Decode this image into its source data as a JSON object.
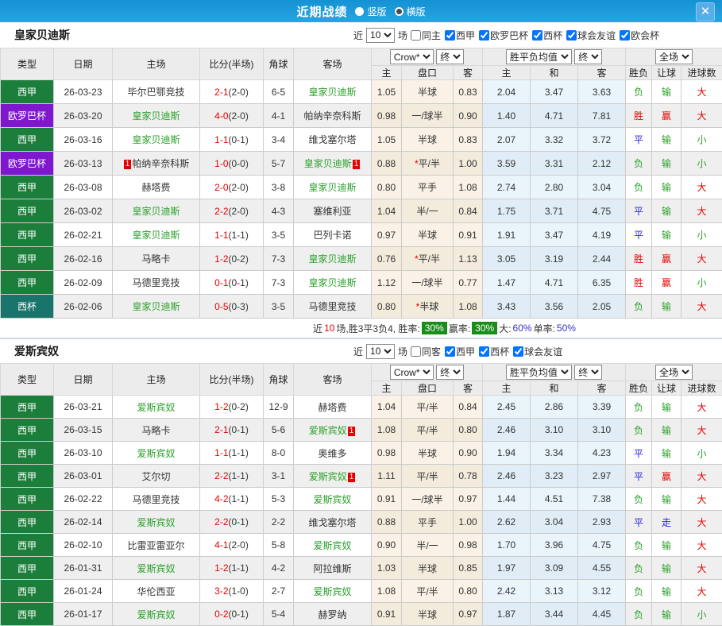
{
  "titlebar": {
    "title": "近期战绩",
    "radio_vertical": "竖版",
    "radio_horizontal": "横版",
    "close": "✕"
  },
  "header": {
    "near": "近",
    "games": "10",
    "games_unit": "场",
    "col_type": "类型",
    "col_date": "日期",
    "col_home": "主场",
    "col_score": "比分(半场)",
    "col_corner": "角球",
    "col_away": "客场",
    "dd_odds_src": "Crow*",
    "dd_odds_state": "终",
    "dd_avg_src": "胜平负均值",
    "dd_avg_state": "终",
    "dd_scope": "全场",
    "sub_odds": [
      "主",
      "盘口",
      "客"
    ],
    "sub_avg": [
      "主",
      "和",
      "客"
    ],
    "sub_res": [
      "胜负",
      "让球",
      "进球数"
    ]
  },
  "colors": {
    "league": {
      "西甲": "#1b7e3a",
      "欧罗巴杯": "#7e17cd",
      "西杯": "#19756c"
    },
    "win_red": "#e60000",
    "draw_blue": "#2828d8",
    "lose_green": "#2ba12b"
  },
  "sections": [
    {
      "team": "皇家贝迪斯",
      "filters": [
        {
          "label": "同主",
          "checked": false
        },
        {
          "label": "西甲",
          "checked": true
        },
        {
          "label": "欧罗巴杯",
          "checked": true
        },
        {
          "label": "西杯",
          "checked": true
        },
        {
          "label": "球会友谊",
          "checked": true
        },
        {
          "label": "欧会杯",
          "checked": true
        }
      ],
      "rows": [
        {
          "league": "西甲",
          "date": "26-03-23",
          "home": "毕尔巴鄂竞技",
          "home_hl": false,
          "home_card": false,
          "score": "2-1",
          "half": "(2-0)",
          "corner": "6-5",
          "away": "皇家贝迪斯",
          "away_hl": true,
          "away_card": false,
          "odds": [
            "1.05",
            "半球",
            "0.83"
          ],
          "star": false,
          "avg": [
            "2.04",
            "3.47",
            "3.63"
          ],
          "res": [
            "负",
            "输",
            "大"
          ]
        },
        {
          "league": "欧罗巴杯",
          "date": "26-03-20",
          "home": "皇家贝迪斯",
          "home_hl": true,
          "home_card": false,
          "score": "4-0",
          "half": "(2-0)",
          "corner": "4-1",
          "away": "帕纳辛奈科斯",
          "away_hl": false,
          "away_card": false,
          "odds": [
            "0.98",
            "一/球半",
            "0.90"
          ],
          "star": false,
          "avg": [
            "1.40",
            "4.71",
            "7.81"
          ],
          "res": [
            "胜",
            "赢",
            "大"
          ]
        },
        {
          "league": "西甲",
          "date": "26-03-16",
          "home": "皇家贝迪斯",
          "home_hl": true,
          "home_card": false,
          "score": "1-1",
          "half": "(0-1)",
          "corner": "3-4",
          "away": "维戈塞尔塔",
          "away_hl": false,
          "away_card": false,
          "odds": [
            "1.05",
            "半球",
            "0.83"
          ],
          "star": false,
          "avg": [
            "2.07",
            "3.32",
            "3.72"
          ],
          "res": [
            "平",
            "输",
            "小"
          ]
        },
        {
          "league": "欧罗巴杯",
          "date": "26-03-13",
          "home": "帕纳辛奈科斯",
          "home_hl": false,
          "home_card": true,
          "score": "1-0",
          "half": "(0-0)",
          "corner": "5-7",
          "away": "皇家贝迪斯",
          "away_hl": true,
          "away_card": true,
          "odds": [
            "0.88",
            "平/半",
            "1.00"
          ],
          "star": true,
          "avg": [
            "3.59",
            "3.31",
            "2.12"
          ],
          "res": [
            "负",
            "输",
            "小"
          ]
        },
        {
          "league": "西甲",
          "date": "26-03-08",
          "home": "赫塔费",
          "home_hl": false,
          "home_card": false,
          "score": "2-0",
          "half": "(2-0)",
          "corner": "3-8",
          "away": "皇家贝迪斯",
          "away_hl": true,
          "away_card": false,
          "odds": [
            "0.80",
            "平手",
            "1.08"
          ],
          "star": false,
          "avg": [
            "2.74",
            "2.80",
            "3.04"
          ],
          "res": [
            "负",
            "输",
            "大"
          ]
        },
        {
          "league": "西甲",
          "date": "26-03-02",
          "home": "皇家贝迪斯",
          "home_hl": true,
          "home_card": false,
          "score": "2-2",
          "half": "(2-0)",
          "corner": "4-3",
          "away": "塞维利亚",
          "away_hl": false,
          "away_card": false,
          "odds": [
            "1.04",
            "半/一",
            "0.84"
          ],
          "star": false,
          "avg": [
            "1.75",
            "3.71",
            "4.75"
          ],
          "res": [
            "平",
            "输",
            "大"
          ]
        },
        {
          "league": "西甲",
          "date": "26-02-21",
          "home": "皇家贝迪斯",
          "home_hl": true,
          "home_card": false,
          "score": "1-1",
          "half": "(1-1)",
          "corner": "3-5",
          "away": "巴列卡诺",
          "away_hl": false,
          "away_card": false,
          "odds": [
            "0.97",
            "半球",
            "0.91"
          ],
          "star": false,
          "avg": [
            "1.91",
            "3.47",
            "4.19"
          ],
          "res": [
            "平",
            "输",
            "小"
          ]
        },
        {
          "league": "西甲",
          "date": "26-02-16",
          "home": "马略卡",
          "home_hl": false,
          "home_card": false,
          "score": "1-2",
          "half": "(0-2)",
          "corner": "7-3",
          "away": "皇家贝迪斯",
          "away_hl": true,
          "away_card": false,
          "odds": [
            "0.76",
            "平/半",
            "1.13"
          ],
          "star": true,
          "avg": [
            "3.05",
            "3.19",
            "2.44"
          ],
          "res": [
            "胜",
            "赢",
            "大"
          ]
        },
        {
          "league": "西甲",
          "date": "26-02-09",
          "home": "马德里竞技",
          "home_hl": false,
          "home_card": false,
          "score": "0-1",
          "half": "(0-1)",
          "corner": "7-3",
          "away": "皇家贝迪斯",
          "away_hl": true,
          "away_card": false,
          "odds": [
            "1.12",
            "一/球半",
            "0.77"
          ],
          "star": false,
          "avg": [
            "1.47",
            "4.71",
            "6.35"
          ],
          "res": [
            "胜",
            "赢",
            "小"
          ]
        },
        {
          "league": "西杯",
          "date": "26-02-06",
          "home": "皇家贝迪斯",
          "home_hl": true,
          "home_card": false,
          "score": "0-5",
          "half": "(0-3)",
          "corner": "3-5",
          "away": "马德里竞技",
          "away_hl": false,
          "away_card": false,
          "odds": [
            "0.80",
            "半球",
            "1.08"
          ],
          "star": true,
          "avg": [
            "3.43",
            "3.56",
            "2.05"
          ],
          "res": [
            "负",
            "输",
            "大"
          ]
        }
      ],
      "summary": {
        "pre": "近",
        "n": "10",
        "mid": "场,胜3平3负4, 胜率:",
        "win_rate": "30%",
        "mid2": "赢率:",
        "profit_rate": "30%",
        "mid3": "大:",
        "big_rate": "60%",
        "mid4": "单率:",
        "single_rate": "50%"
      }
    },
    {
      "team": "爱斯宾奴",
      "filters": [
        {
          "label": "同客",
          "checked": false
        },
        {
          "label": "西甲",
          "checked": true
        },
        {
          "label": "西杯",
          "checked": true
        },
        {
          "label": "球会友谊",
          "checked": true
        }
      ],
      "rows": [
        {
          "league": "西甲",
          "date": "26-03-21",
          "home": "爱斯宾奴",
          "home_hl": true,
          "home_card": false,
          "score": "1-2",
          "half": "(0-2)",
          "corner": "12-9",
          "away": "赫塔费",
          "away_hl": false,
          "away_card": false,
          "odds": [
            "1.04",
            "平/半",
            "0.84"
          ],
          "star": false,
          "avg": [
            "2.45",
            "2.86",
            "3.39"
          ],
          "res": [
            "负",
            "输",
            "大"
          ]
        },
        {
          "league": "西甲",
          "date": "26-03-15",
          "home": "马略卡",
          "home_hl": false,
          "home_card": false,
          "score": "2-1",
          "half": "(0-1)",
          "corner": "5-6",
          "away": "爱斯宾奴",
          "away_hl": true,
          "away_card": true,
          "odds": [
            "1.08",
            "平/半",
            "0.80"
          ],
          "star": false,
          "avg": [
            "2.46",
            "3.10",
            "3.10"
          ],
          "res": [
            "负",
            "输",
            "大"
          ]
        },
        {
          "league": "西甲",
          "date": "26-03-10",
          "home": "爱斯宾奴",
          "home_hl": true,
          "home_card": false,
          "score": "1-1",
          "half": "(1-1)",
          "corner": "8-0",
          "away": "奥维多",
          "away_hl": false,
          "away_card": false,
          "odds": [
            "0.98",
            "半球",
            "0.90"
          ],
          "star": false,
          "avg": [
            "1.94",
            "3.34",
            "4.23"
          ],
          "res": [
            "平",
            "输",
            "小"
          ]
        },
        {
          "league": "西甲",
          "date": "26-03-01",
          "home": "艾尔切",
          "home_hl": false,
          "home_card": false,
          "score": "2-2",
          "half": "(1-1)",
          "corner": "3-1",
          "away": "爱斯宾奴",
          "away_hl": true,
          "away_card": true,
          "odds": [
            "1.11",
            "平/半",
            "0.78"
          ],
          "star": false,
          "avg": [
            "2.46",
            "3.23",
            "2.97"
          ],
          "res": [
            "平",
            "赢",
            "大"
          ]
        },
        {
          "league": "西甲",
          "date": "26-02-22",
          "home": "马德里竞技",
          "home_hl": false,
          "home_card": false,
          "score": "4-2",
          "half": "(1-1)",
          "corner": "5-3",
          "away": "爱斯宾奴",
          "away_hl": true,
          "away_card": false,
          "odds": [
            "0.91",
            "一/球半",
            "0.97"
          ],
          "star": false,
          "avg": [
            "1.44",
            "4.51",
            "7.38"
          ],
          "res": [
            "负",
            "输",
            "大"
          ]
        },
        {
          "league": "西甲",
          "date": "26-02-14",
          "home": "爱斯宾奴",
          "home_hl": true,
          "home_card": false,
          "score": "2-2",
          "half": "(0-1)",
          "corner": "2-2",
          "away": "维戈塞尔塔",
          "away_hl": false,
          "away_card": false,
          "odds": [
            "0.88",
            "平手",
            "1.00"
          ],
          "star": false,
          "avg": [
            "2.62",
            "3.04",
            "2.93"
          ],
          "res": [
            "平",
            "走",
            "大"
          ]
        },
        {
          "league": "西甲",
          "date": "26-02-10",
          "home": "比雷亚雷亚尔",
          "home_hl": false,
          "home_card": false,
          "score": "4-1",
          "half": "(2-0)",
          "corner": "5-8",
          "away": "爱斯宾奴",
          "away_hl": true,
          "away_card": false,
          "odds": [
            "0.90",
            "半/一",
            "0.98"
          ],
          "star": false,
          "avg": [
            "1.70",
            "3.96",
            "4.75"
          ],
          "res": [
            "负",
            "输",
            "大"
          ]
        },
        {
          "league": "西甲",
          "date": "26-01-31",
          "home": "爱斯宾奴",
          "home_hl": true,
          "home_card": false,
          "score": "1-2",
          "half": "(1-1)",
          "corner": "4-2",
          "away": "阿拉维斯",
          "away_hl": false,
          "away_card": false,
          "odds": [
            "1.03",
            "半球",
            "0.85"
          ],
          "star": false,
          "avg": [
            "1.97",
            "3.09",
            "4.55"
          ],
          "res": [
            "负",
            "输",
            "大"
          ]
        },
        {
          "league": "西甲",
          "date": "26-01-24",
          "home": "华伦西亚",
          "home_hl": false,
          "home_card": false,
          "score": "3-2",
          "half": "(1-0)",
          "corner": "2-7",
          "away": "爱斯宾奴",
          "away_hl": true,
          "away_card": false,
          "odds": [
            "1.08",
            "平/半",
            "0.80"
          ],
          "star": false,
          "avg": [
            "2.42",
            "3.13",
            "3.12"
          ],
          "res": [
            "负",
            "输",
            "大"
          ]
        },
        {
          "league": "西甲",
          "date": "26-01-17",
          "home": "爱斯宾奴",
          "home_hl": true,
          "home_card": false,
          "score": "0-2",
          "half": "(0-1)",
          "corner": "5-4",
          "away": "赫罗纳",
          "away_hl": false,
          "away_card": false,
          "odds": [
            "0.91",
            "半球",
            "0.97"
          ],
          "star": false,
          "avg": [
            "1.87",
            "3.44",
            "4.45"
          ],
          "res": [
            "负",
            "输",
            "小"
          ]
        }
      ],
      "summary": null
    }
  ]
}
